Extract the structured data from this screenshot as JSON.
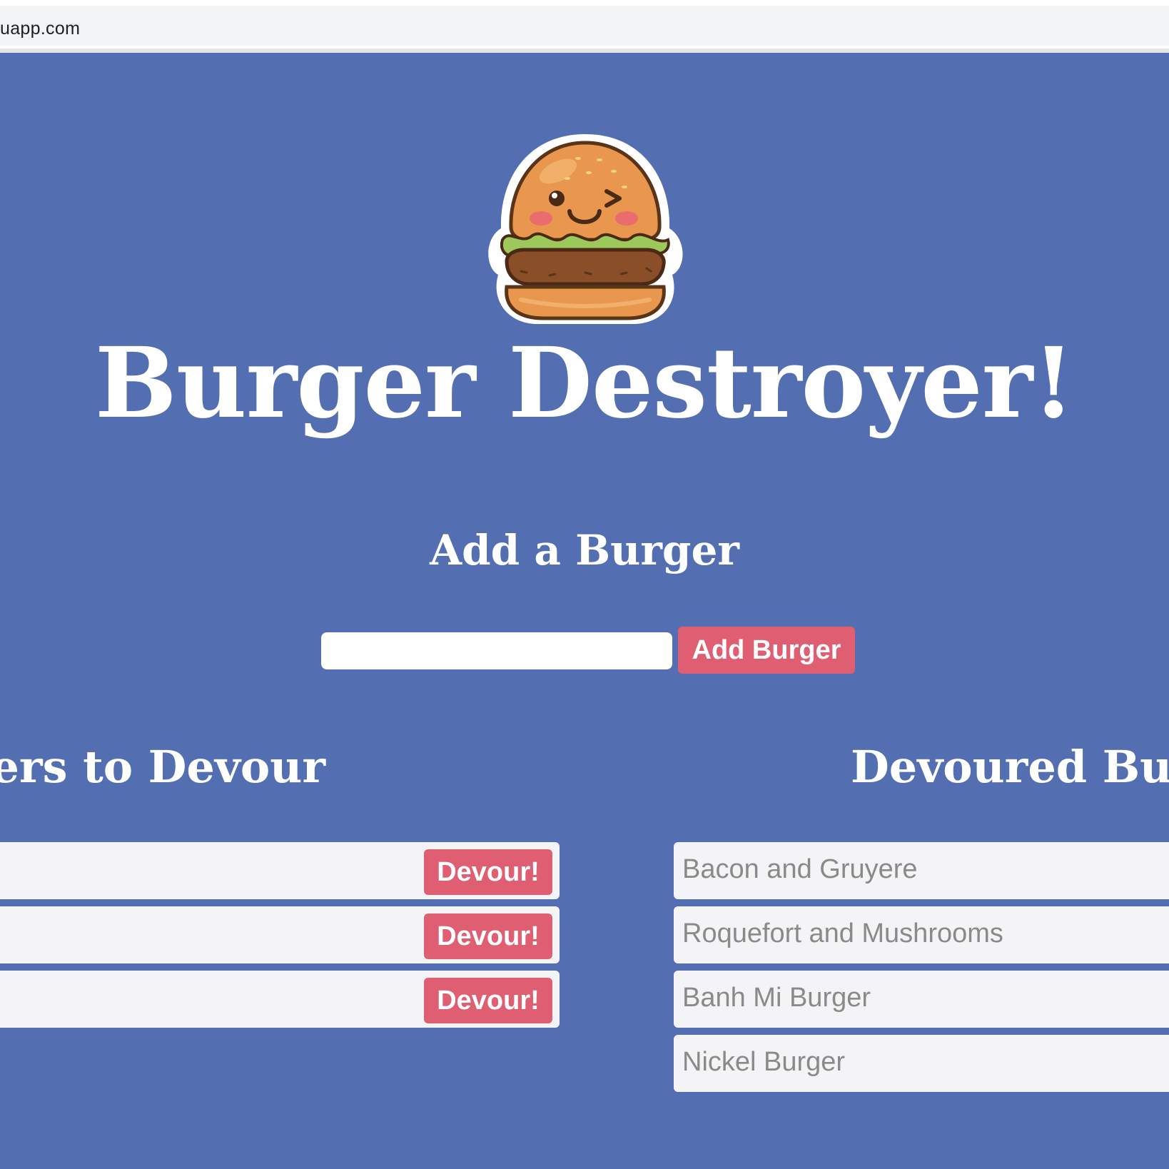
{
  "browser": {
    "url": "uapp.com"
  },
  "page": {
    "title": "Burger Destroyer!",
    "add_heading": "Add a Burger",
    "input_value": "",
    "add_button_label": "Add Burger"
  },
  "to_devour": {
    "heading": "Burgers to Devour",
    "items": [
      {
        "name": "",
        "button_label": "Devour!"
      },
      {
        "name": "",
        "button_label": "Devour!"
      },
      {
        "name": "",
        "button_label": "Devour!"
      }
    ]
  },
  "devoured": {
    "heading": "Devoured Burgers",
    "items": [
      {
        "name": "Bacon and Gruyere"
      },
      {
        "name": "Roquefort and Mushrooms"
      },
      {
        "name": "Banh Mi Burger"
      },
      {
        "name": "Nickel Burger"
      }
    ]
  },
  "colors": {
    "background": "#536eb1",
    "accent_button": "#e05e72",
    "list_item_bg": "#f4f3f5",
    "devoured_text": "#8a8a8a"
  }
}
